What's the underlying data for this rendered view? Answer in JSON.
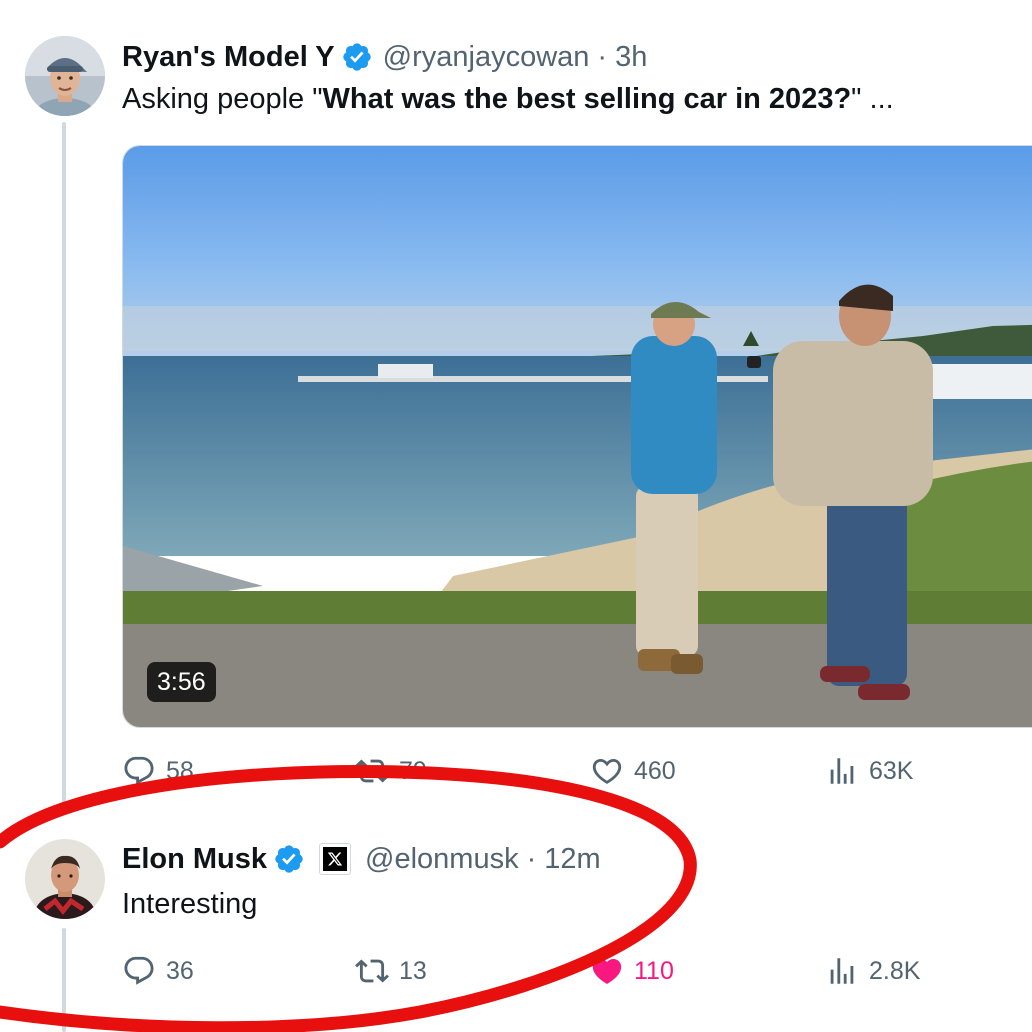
{
  "tweet1": {
    "display_name": "Ryan's Model Y",
    "handle": "@ryanjaycowan",
    "separator": "·",
    "time": "3h",
    "text_prefix": "Asking people \"",
    "text_bold": "What was the best selling car in 2023?",
    "text_suffix": "\" ...",
    "media": {
      "duration": "3:56"
    },
    "actions": {
      "replies": "58",
      "retweets": "79",
      "likes": "460",
      "views": "63K"
    }
  },
  "tweet2": {
    "display_name": "Elon Musk",
    "handle": "@elonmusk",
    "separator": "·",
    "time": "12m",
    "text": "Interesting",
    "actions": {
      "replies": "36",
      "retweets": "13",
      "likes": "110",
      "views": "2.8K"
    }
  },
  "colors": {
    "verified": "#1d9bf0",
    "liked": "#f91880",
    "secondary_text": "#536471",
    "annotation": "#e8100f",
    "thread_line": "#cfd9de"
  },
  "icons": [
    "reply-icon",
    "retweet-icon",
    "like-icon",
    "views-icon",
    "verified-badge-icon",
    "x-logo-icon"
  ]
}
